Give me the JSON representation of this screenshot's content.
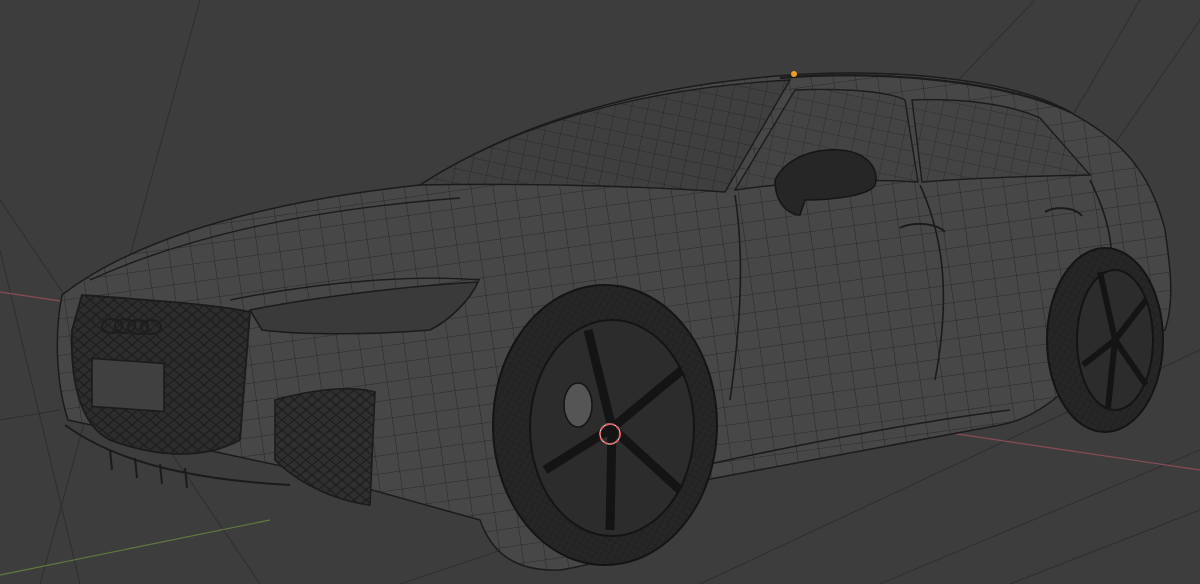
{
  "viewport": {
    "background_color": "#3d3d3d",
    "grid_line_color": "#2e2e2e",
    "x_axis_color": "#8a4c55",
    "y_axis_color": "#5f7a3e",
    "wireframe_color": "#1b1b1b",
    "body_color": "#474747",
    "wheel_color": "#262626",
    "selected_vertex_color": "#f0a020",
    "origin_marker_color": "#e06060"
  },
  "scene": {
    "object": "car-wireframe-mesh",
    "icons": [
      "car-mesh-icon",
      "origin-marker-icon",
      "selected-vertex-icon"
    ]
  }
}
